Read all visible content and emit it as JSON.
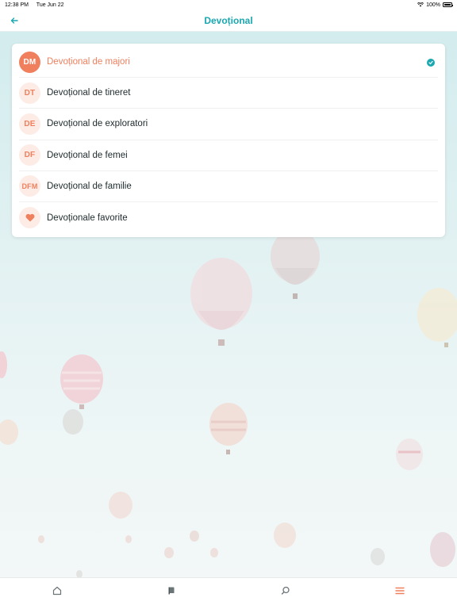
{
  "status_bar": {
    "time": "12:38 PM",
    "date": "Tue Jun 22",
    "battery": "100%",
    "wifi_icon": "wifi-icon",
    "battery_icon": "battery-icon"
  },
  "header": {
    "title": "Devoțional",
    "back_icon": "arrow-left-icon"
  },
  "menu": {
    "items": [
      {
        "badge": "DM",
        "label": "Devoțional de majori",
        "selected": true
      },
      {
        "badge": "DT",
        "label": "Devoțional de tineret",
        "selected": false
      },
      {
        "badge": "DE",
        "label": "Devoțional de exploratori",
        "selected": false
      },
      {
        "badge": "DF",
        "label": "Devoțional de femei",
        "selected": false
      },
      {
        "badge": "DFM",
        "label": "Devoțional de familie",
        "selected": false
      },
      {
        "badge_icon": "heart-icon",
        "label": "Devoționale favorite",
        "selected": false
      }
    ],
    "selected_icon": "check-icon"
  },
  "tab_bar": {
    "tabs": [
      {
        "icon": "home-icon",
        "active": false
      },
      {
        "icon": "book-icon",
        "active": false
      },
      {
        "icon": "search-icon",
        "active": false
      },
      {
        "icon": "menu-icon",
        "active": true
      }
    ]
  },
  "colors": {
    "accent": "#1aa7b0",
    "brand": "#f07f5d",
    "badge_bg": "#fdece6"
  }
}
